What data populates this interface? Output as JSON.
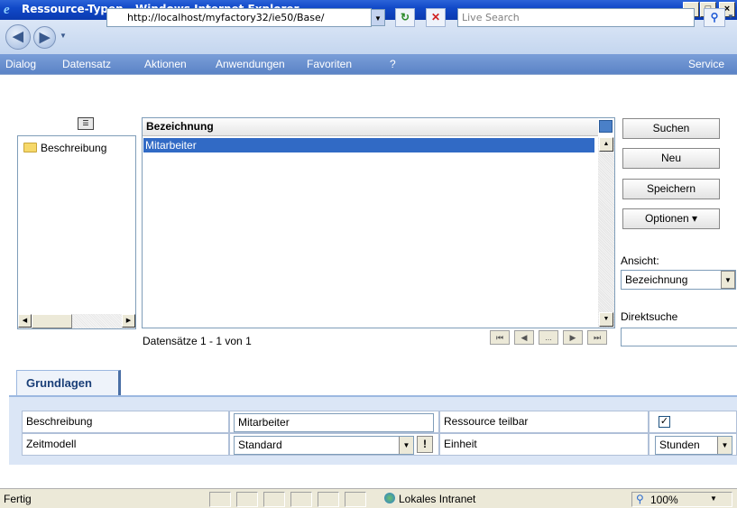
{
  "window": {
    "title": "Ressource-Typen - Windows Internet Explorer",
    "minimize": "_",
    "maximize": "□",
    "close": "×"
  },
  "address": {
    "url": "http://localhost/myfactory32/ie50/Base/",
    "search_placeholder": "Live Search"
  },
  "menu": {
    "items": [
      "Dialog",
      "Datensatz",
      "Aktionen",
      "Anwendungen",
      "Favoriten",
      "?"
    ],
    "service": "Service"
  },
  "tree": {
    "items": [
      {
        "label": "Beschreibung",
        "icon": "folder-icon"
      }
    ]
  },
  "grid": {
    "header": "Bezeichnung",
    "rows": [
      "Mitarbeiter"
    ],
    "record_info": "Datensätze 1 - 1 von 1",
    "pager": [
      "⏮",
      "◀",
      "...",
      "▶",
      "⏭"
    ]
  },
  "actions": {
    "search": "Suchen",
    "new": "Neu",
    "save": "Speichern",
    "options": "Optionen ▾"
  },
  "view": {
    "label": "Ansicht:",
    "selected": "Bezeichnung",
    "quicksearch_label": "Direktsuche"
  },
  "tabs": [
    {
      "label": "Grundlagen",
      "active": true
    }
  ],
  "form": {
    "row1": {
      "label": "Beschreibung",
      "value": "Mitarbeiter",
      "label2": "Ressource teilbar",
      "checked": true
    },
    "row2": {
      "label": "Zeitmodell",
      "value": "Standard",
      "button": "!",
      "label2": "Einheit",
      "value2": "Stunden"
    }
  },
  "status": {
    "text": "Fertig",
    "zone": "Lokales Intranet",
    "zoom": "100%"
  },
  "colors": {
    "titlebar": "#1149c8",
    "menubar": "#5b83c6",
    "selection": "#316ac5",
    "tab_text": "#1a3f78"
  }
}
